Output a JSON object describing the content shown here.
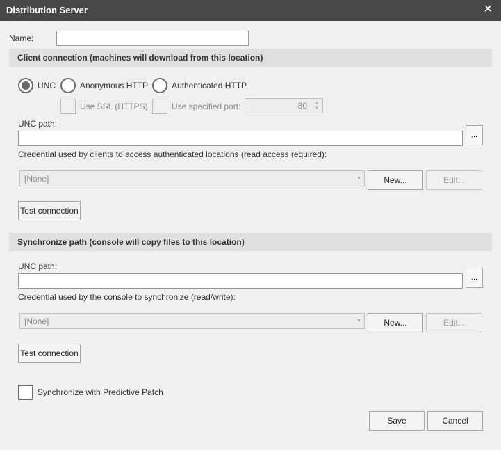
{
  "window": {
    "title": "Distribution Server",
    "close_glyph": "✕"
  },
  "name_field": {
    "label": "Name:",
    "value": ""
  },
  "client_connection": {
    "header": "Client connection (machines will download from this location)",
    "radios": [
      {
        "label": "UNC",
        "selected": true
      },
      {
        "label": "Anonymous HTTP",
        "selected": false
      },
      {
        "label": "Authenticated HTTP",
        "selected": false
      }
    ],
    "use_ssl_label": "Use SSL (HTTPS)",
    "use_port_label": "Use specified port:",
    "port_value": "80",
    "unc_path_label": "UNC path:",
    "unc_path_value": "",
    "browse_label": "...",
    "credential_label": "Credential used by clients to access authenticated locations (read access required):",
    "credential_value": "[None]",
    "new_label": "New...",
    "edit_label": "Edit...",
    "test_label": "Test connection"
  },
  "synchronize_path": {
    "header": "Synchronize path (console will copy files to this location)",
    "unc_path_label": "UNC path:",
    "unc_path_value": "",
    "browse_label": "...",
    "credential_label": "Credential used by the console to synchronize (read/write):",
    "credential_value": "[None]",
    "new_label": "New...",
    "edit_label": "Edit...",
    "test_label": "Test connection"
  },
  "predictive_patch": {
    "label": "Synchronize with Predictive Patch",
    "checked": false
  },
  "footer": {
    "save_label": "Save",
    "cancel_label": "Cancel"
  }
}
